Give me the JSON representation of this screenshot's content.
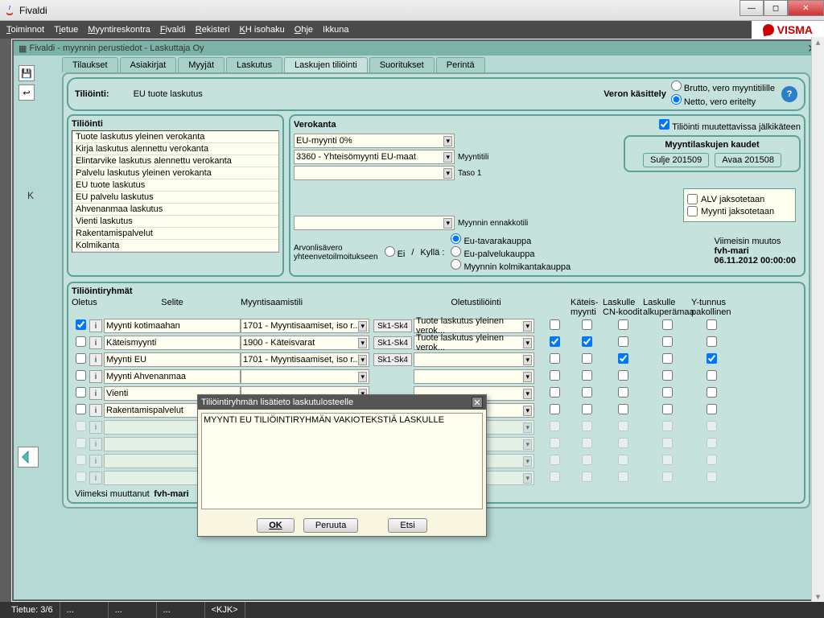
{
  "window": {
    "title": "Fivaldi"
  },
  "menubar": [
    "Toiminnot",
    "Tietue",
    "Myyntireskontra",
    "Fivaldi",
    "Rekisteri",
    "KH isohaku",
    "Ohje",
    "Ikkuna"
  ],
  "brand": "VISMA",
  "inner_title": "Fivaldi - myynnin perustiedot - Laskuttaja Oy",
  "tabs": [
    "Tilaukset",
    "Asiakirjat",
    "Myyjät",
    "Laskutus",
    "Laskujen tiliöinti",
    "Suoritukset",
    "Perintä"
  ],
  "active_tab": 4,
  "header": {
    "label": "Tiliöinti:",
    "value": "EU tuote laskutus",
    "vero_label": "Veron käsittely",
    "radio_brutto": "Brutto, vero myyntitilille",
    "radio_netto": "Netto, vero eritelty"
  },
  "tilioin_list_label": "Tiliöinti",
  "tilioin_list": [
    "Tuote laskutus yleinen verokanta",
    "Kirja laskutus alennettu verokanta",
    "Elintarvike laskutus alennettu verokanta",
    "Palvelu laskutus yleinen verokanta",
    "EU tuote laskutus",
    "EU palvelu laskutus",
    "Ahvenanmaa laskutus",
    "Vienti laskutus",
    "Rakentamispalvelut",
    "Kolmikanta"
  ],
  "right": {
    "verokanta_label": "Verokanta",
    "muutettavissa": "Tiliöinti muutettavissa jälkikäteen",
    "verokanta_value": "EU-myynti 0%",
    "myyntitili_value": "3360 - Yhteisömyynti EU-maat",
    "myyntitili_label": "Myyntitili",
    "taso1_label": "Taso 1",
    "kaudet_title": "Myyntilaskujen kaudet",
    "sulje": "Sulje 201509",
    "avaa": "Avaa 201508",
    "alv_label": "ALV jaksotetaan",
    "myynti_jaks": "Myynti jaksotetaan",
    "viimeisin": "Viimeisin muutos",
    "muuttaja": "fvh-mari",
    "muutos_aika": "06.11.2012 00:00:00",
    "ennakkotili_label": "Myynnin ennakkotili",
    "arvonlisa": "Arvonlisävero\nyhteenvetoilmoitukseen",
    "ei": "Ei",
    "kylla": "Kyllä :",
    "radio_opts": [
      "Eu-tavarakauppa",
      "Eu-palvelukauppa",
      "Myynnin kolmikantakauppa"
    ]
  },
  "groups": {
    "heading": "Tiliöintiryhmät",
    "cols": {
      "oletus": "Oletus",
      "selite": "Selite",
      "myynti": "Myyntisaamistili",
      "oletustili": "Oletustiliöinti",
      "kateis": "Käteis-\nmyynti",
      "laskulle_cn": "Laskulle\nCN-koodit",
      "laskulle_alku": "Laskulle\nalkuperämaa",
      "ytunnus": "Y-tunnus\npakollinen"
    },
    "rows": [
      {
        "oletus": true,
        "selite": "Myynti kotimaahan",
        "myynti": "1701 - Myyntisaamiset, iso r...",
        "sk": "Sk1-Sk4",
        "oletustili": "Tuote laskutus yleinen verok...",
        "cb1": false,
        "k": false,
        "cn": false,
        "al": false,
        "yt": false,
        "disabled": false
      },
      {
        "oletus": false,
        "selite": "Käteismyynti",
        "myynti": "1900 - Käteisvarat",
        "sk": "Sk1-Sk4",
        "oletustili": "Tuote laskutus yleinen verok...",
        "cb1": true,
        "k": true,
        "cn": false,
        "al": false,
        "yt": false,
        "disabled": false
      },
      {
        "oletus": false,
        "selite": "Myynti EU",
        "myynti": "1701 - Myyntisaamiset, iso r...",
        "sk": "Sk1-Sk4",
        "oletustili": "",
        "cb1": false,
        "k": false,
        "cn": true,
        "al": false,
        "yt": true,
        "disabled": false
      },
      {
        "oletus": false,
        "selite": "Myynti Ahvenanmaa",
        "myynti": "",
        "sk": "",
        "oletustili": "",
        "cb1": false,
        "k": false,
        "cn": false,
        "al": false,
        "yt": false,
        "disabled": false
      },
      {
        "oletus": false,
        "selite": "Vienti",
        "myynti": "",
        "sk": "",
        "oletustili": "",
        "cb1": false,
        "k": false,
        "cn": false,
        "al": false,
        "yt": false,
        "disabled": false
      },
      {
        "oletus": false,
        "selite": "Rakentamispalvelut",
        "myynti": "",
        "sk": "",
        "oletustili": "",
        "cb1": false,
        "k": false,
        "cn": false,
        "al": false,
        "yt": false,
        "disabled": false
      },
      {
        "oletus": false,
        "selite": "",
        "myynti": "",
        "sk": "",
        "oletustili": "",
        "cb1": false,
        "k": false,
        "cn": false,
        "al": false,
        "yt": false,
        "disabled": true
      },
      {
        "oletus": false,
        "selite": "",
        "myynti": "",
        "sk": "",
        "oletustili": "",
        "cb1": false,
        "k": false,
        "cn": false,
        "al": false,
        "yt": false,
        "disabled": true
      },
      {
        "oletus": false,
        "selite": "",
        "myynti": "",
        "sk": "",
        "oletustili": "",
        "cb1": false,
        "k": false,
        "cn": false,
        "al": false,
        "yt": false,
        "disabled": true
      },
      {
        "oletus": false,
        "selite": "",
        "myynti": "",
        "sk": "",
        "oletustili": "",
        "cb1": false,
        "k": false,
        "cn": false,
        "al": false,
        "yt": false,
        "disabled": true
      }
    ]
  },
  "viimeksi": {
    "label": "Viimeksi muuttanut",
    "value": "fvh-mari"
  },
  "dialog": {
    "title": "Tiliöintiryhmän lisätieto laskutulosteelle",
    "text": "MYYNTI EU TILIÖINTIRYHMÄN VAKIOTEKSTIÄ LASKULLE",
    "ok": "OK",
    "peruuta": "Peruuta",
    "etsi": "Etsi"
  },
  "status": {
    "tietue": "Tietue: 3/6",
    "kjk": "<KJK>"
  },
  "k_letter": "K"
}
